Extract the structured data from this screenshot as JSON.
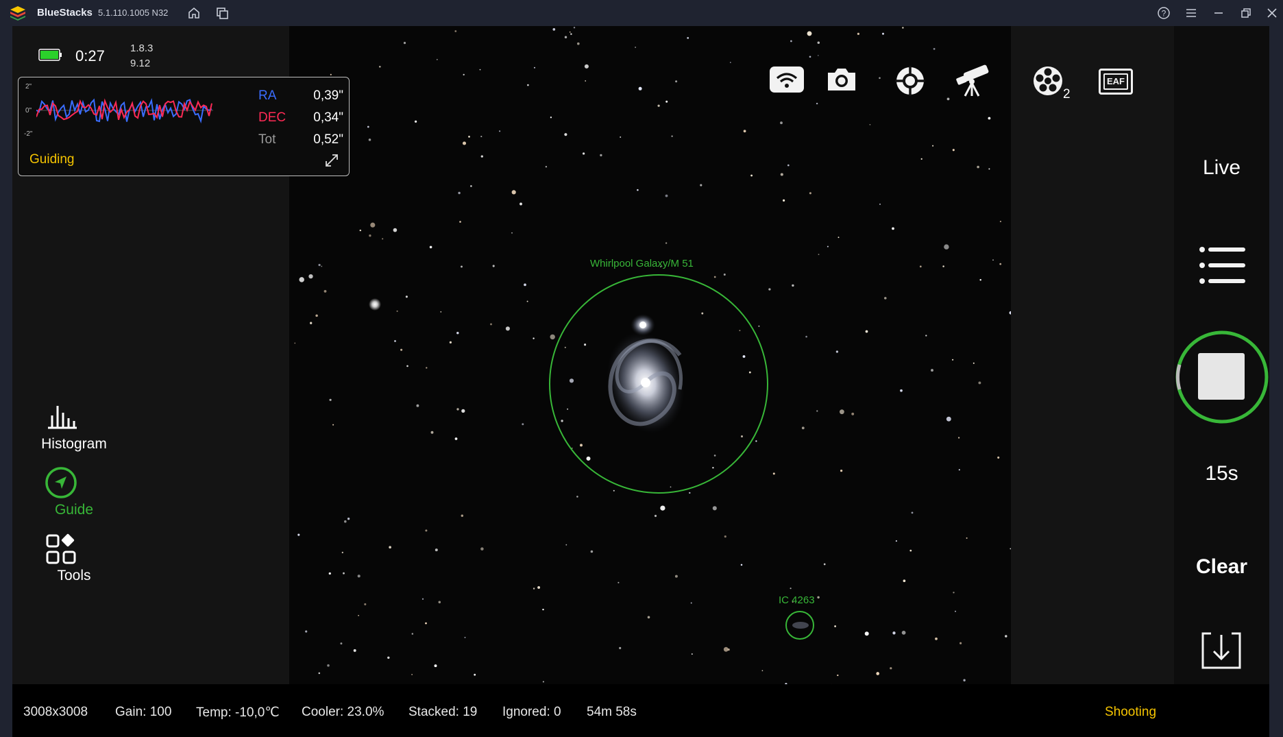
{
  "window": {
    "app_name": "BlueStacks",
    "app_version": "5.1.110.1005  N32"
  },
  "info": {
    "timer": "0:27",
    "version_line1": "1.8.3",
    "version_line2": "9.12",
    "battery_color": "#2bd12b"
  },
  "guiding": {
    "title": "Guiding",
    "y_ticks": [
      "2\"",
      "0\"",
      "-2\""
    ],
    "rows": [
      {
        "label": "RA",
        "value": "0,39\"",
        "color": "#3a6dff"
      },
      {
        "label": "DEC",
        "value": "0,34\"",
        "color": "#ff2a55"
      },
      {
        "label": "Tot",
        "value": "0,52\"",
        "color": "#9a9a9a"
      }
    ]
  },
  "left_nav": {
    "histogram": "Histogram",
    "guide": "Guide",
    "tools": "Tools"
  },
  "toolbar": {
    "icons": [
      "wifi-icon",
      "camera-icon",
      "crosshair-icon",
      "telescope-icon",
      "filter-wheel-icon",
      "eaf-icon",
      "usb-drive-icon",
      "info-icon"
    ],
    "filter_wheel_badge": "2",
    "eaf_label": "EAF"
  },
  "objects": [
    {
      "name": "Whirlpool Galaxy/M 51"
    },
    {
      "name": "IC 4263"
    }
  ],
  "side": {
    "live": "Live",
    "exposure": "15s",
    "clear": "Clear",
    "accent": "#38b738"
  },
  "status": {
    "resolution": "3008x3008",
    "gain": "Gain: 100",
    "temp": "Temp: -10,0℃",
    "cooler": "Cooler: 23.0%",
    "stacked": "Stacked: 19",
    "ignored": "Ignored: 0",
    "elapsed": "54m 58s",
    "state": "Shooting"
  }
}
